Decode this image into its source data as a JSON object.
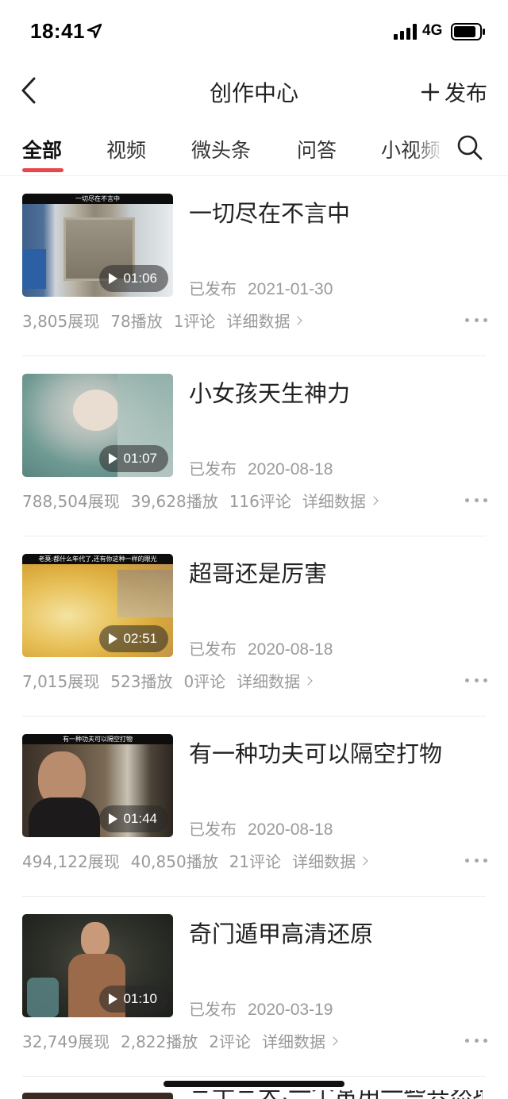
{
  "status_bar": {
    "time": "18:41",
    "network": "4G"
  },
  "nav": {
    "title": "创作中心",
    "publish_label": "发布"
  },
  "tabs": [
    {
      "label": "全部",
      "active": true
    },
    {
      "label": "视频",
      "active": false
    },
    {
      "label": "微头条",
      "active": false
    },
    {
      "label": "问答",
      "active": false
    },
    {
      "label": "小视频",
      "active": false
    }
  ],
  "items": [
    {
      "title": "一切尽在不言中",
      "duration": "01:06",
      "status": "已发布",
      "date": "2021-01-30",
      "impressions": "3,805展现",
      "plays": "78播放",
      "comments": "1评论",
      "detail": "详细数据",
      "thumb_caption": "一切尽在不言中"
    },
    {
      "title": "小女孩天生神力",
      "duration": "01:07",
      "status": "已发布",
      "date": "2020-08-18",
      "impressions": "788,504展现",
      "plays": "39,628播放",
      "comments": "116评论",
      "detail": "详细数据",
      "thumb_caption": ""
    },
    {
      "title": "超哥还是厉害",
      "duration": "02:51",
      "status": "已发布",
      "date": "2020-08-18",
      "impressions": "7,015展现",
      "plays": "523播放",
      "comments": "0评论",
      "detail": "详细数据",
      "thumb_caption": "老莫:都什么年代了,还有你这种一样的眼光"
    },
    {
      "title": "有一种功夫可以隔空打物",
      "duration": "01:44",
      "status": "已发布",
      "date": "2020-08-18",
      "impressions": "494,122展现",
      "plays": "40,850播放",
      "comments": "21评论",
      "detail": "详细数据",
      "thumb_caption": "有一种功夫可以隔空打物"
    },
    {
      "title": "奇门遁甲高清还原",
      "duration": "01:10",
      "status": "已发布",
      "date": "2020-03-19",
      "impressions": "32,749展现",
      "plays": "2,822播放",
      "comments": "2评论",
      "detail": "详细数据",
      "thumb_caption": ""
    }
  ],
  "peek_item": {
    "title": "三十三天,一个常用一些共然地"
  },
  "colors": {
    "accent": "#e8474c",
    "meta_text": "#9a9a9a"
  }
}
